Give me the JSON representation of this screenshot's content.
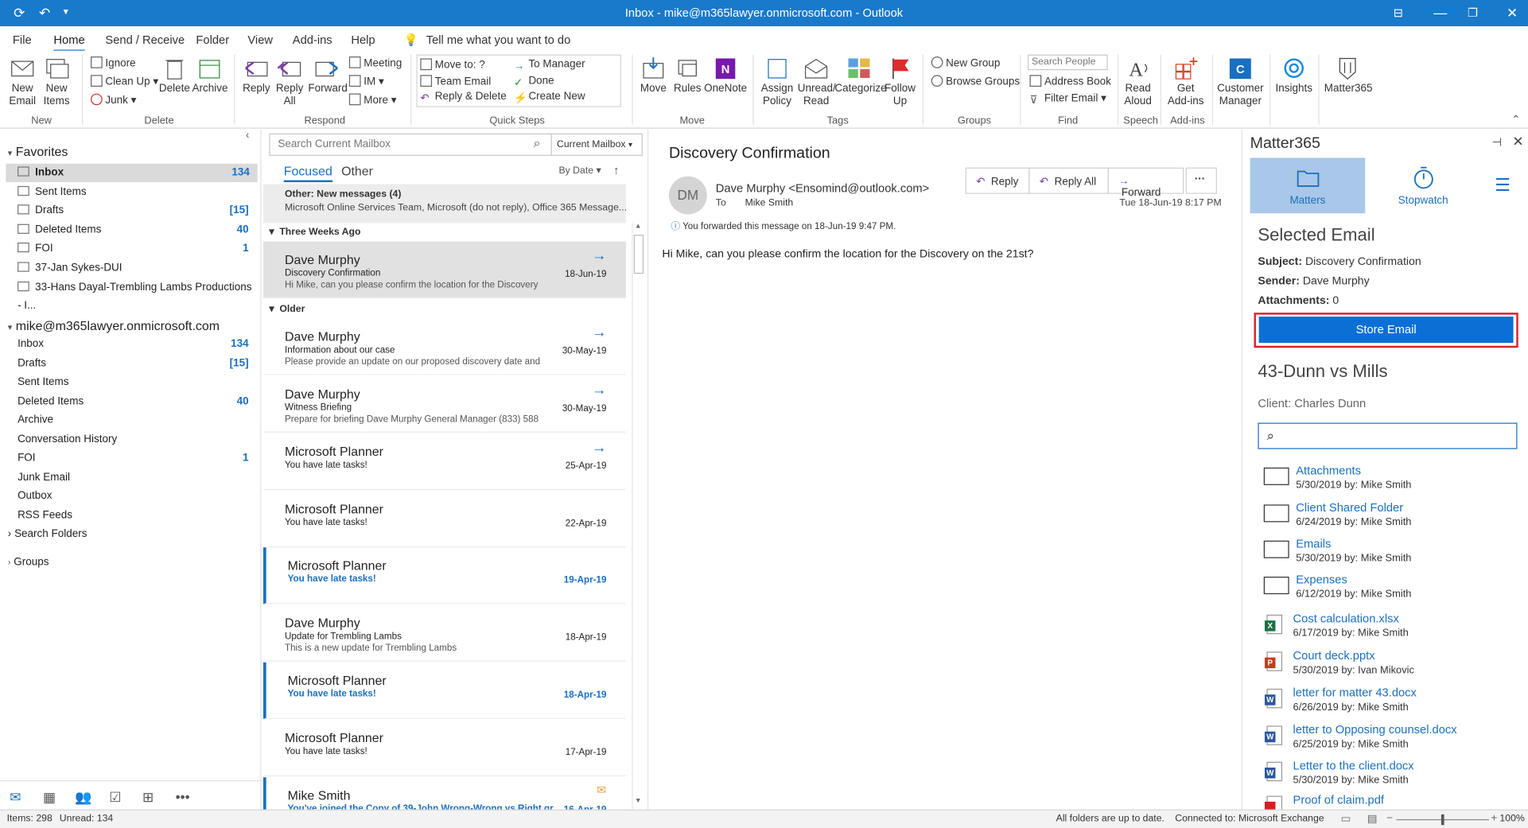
{
  "titlebar": {
    "title": "Inbox - mike@m365lawyer.onmicrosoft.com  -  Outlook"
  },
  "tabs": [
    "File",
    "Home",
    "Send / Receive",
    "Folder",
    "View",
    "Add-ins",
    "Help"
  ],
  "tell_me": "Tell me what you want to do",
  "ribbon": {
    "new_email": "New Email",
    "new_items": "New Items",
    "ignore": "Ignore",
    "clean_up": "Clean Up",
    "junk": "Junk",
    "delete": "Delete",
    "archive": "Archive",
    "reply": "Reply",
    "reply_all": "Reply All",
    "forward": "Forward",
    "meeting": "Meeting",
    "im": "IM",
    "more": "More",
    "quick_steps": [
      "Move to: ?",
      "To Manager",
      "Team Email",
      "Done",
      "Reply & Delete",
      "Create New"
    ],
    "move": "Move",
    "rules": "Rules",
    "onenote": "OneNote",
    "assign_policy": "Assign Policy",
    "unread_read": "Unread/ Read",
    "categorize": "Categorize",
    "follow_up": "Follow Up",
    "new_group": "New Group",
    "browse_groups": "Browse Groups",
    "search_people": "Search People",
    "address_book": "Address Book",
    "filter_email": "Filter Email",
    "read_aloud": "Read Aloud",
    "get_addins": "Get Add-ins",
    "customer_manager": "Customer Manager",
    "insights": "Insights",
    "matter365": "Matter365",
    "groups": [
      "New",
      "Delete",
      "Respond",
      "Quick Steps",
      "Move",
      "Tags",
      "Groups",
      "Find",
      "Speech",
      "Add-ins"
    ]
  },
  "nav": {
    "favorites": "Favorites",
    "fav_items": [
      {
        "label": "Inbox",
        "count": "134"
      },
      {
        "label": "Sent Items",
        "count": ""
      },
      {
        "label": "Drafts",
        "count": "[15]"
      },
      {
        "label": "Deleted Items",
        "count": "40"
      },
      {
        "label": "FOI",
        "count": "1"
      },
      {
        "label": "37-Jan Sykes-DUI",
        "count": ""
      },
      {
        "label": "33-Hans Dayal-Trembling Lambs Productions - I...",
        "count": ""
      }
    ],
    "account": "mike@m365lawyer.onmicrosoft.com",
    "acc_items": [
      {
        "label": "Inbox",
        "count": "134"
      },
      {
        "label": "Drafts",
        "count": "[15]"
      },
      {
        "label": "Sent Items",
        "count": ""
      },
      {
        "label": "Deleted Items",
        "count": "40"
      },
      {
        "label": "Archive",
        "count": ""
      },
      {
        "label": "Conversation History",
        "count": ""
      },
      {
        "label": "FOI",
        "count": "1"
      },
      {
        "label": "Junk Email",
        "count": ""
      },
      {
        "label": "Outbox",
        "count": ""
      },
      {
        "label": "RSS Feeds",
        "count": ""
      },
      {
        "label": "Search Folders",
        "count": ""
      }
    ],
    "groups": "Groups"
  },
  "list": {
    "search_placeholder": "Search Current Mailbox",
    "scope": "Current Mailbox",
    "focused": "Focused",
    "other": "Other",
    "sort": "By Date",
    "other_notice_title": "Other: New messages (4)",
    "other_notice_text": "Microsoft Online Services Team, Microsoft (do not reply), Office 365 Message...",
    "group_three_weeks": "Three Weeks Ago",
    "group_older": "Older",
    "messages": [
      {
        "sender": "Dave Murphy",
        "subject": "Discovery Confirmation",
        "preview": "Hi Mike, can you please confirm the location for the Discovery",
        "date": "18-Jun-19"
      },
      {
        "sender": "Dave Murphy",
        "subject": "Information about our case",
        "preview": "Please provide an update on our proposed discovery date and",
        "date": "30-May-19"
      },
      {
        "sender": "Dave Murphy",
        "subject": "Witness Briefing",
        "preview": "Prepare for briefing   Dave Murphy  General Manager  (833) 588",
        "date": "30-May-19"
      },
      {
        "sender": "Microsoft Planner",
        "subject": "You have late tasks!",
        "preview": "",
        "date": "25-Apr-19"
      },
      {
        "sender": "Microsoft Planner",
        "subject": "You have late tasks!",
        "preview": "",
        "date": "22-Apr-19"
      },
      {
        "sender": "Microsoft Planner",
        "subject": "You have late tasks!",
        "preview": "",
        "date": "19-Apr-19"
      },
      {
        "sender": "Dave Murphy",
        "subject": "Update for Trembling Lambs",
        "preview": "This is a new update for Trembling Lambs",
        "date": "18-Apr-19"
      },
      {
        "sender": "Microsoft Planner",
        "subject": "You have late tasks!",
        "preview": "",
        "date": "18-Apr-19"
      },
      {
        "sender": "Microsoft Planner",
        "subject": "You have late tasks!",
        "preview": "",
        "date": "17-Apr-19"
      },
      {
        "sender": "Mike Smith",
        "subject": "You've joined the Copy of 39-John Wrong-Wrong vs Right gr...",
        "preview": "",
        "date": "16-Apr-19"
      }
    ]
  },
  "reading": {
    "subject": "Discovery Confirmation",
    "initials": "DM",
    "from": "Dave Murphy <Ensomind@outlook.com>",
    "to_label": "To",
    "to": "Mike Smith",
    "reply": "Reply",
    "reply_all": "Reply All",
    "forward": "Forward",
    "date": "Tue 18-Jun-19 8:17 PM",
    "info": "You forwarded this message on 18-Jun-19 9:47 PM.",
    "body": "Hi Mike, can you please confirm the location for the Discovery on the 21st?"
  },
  "side": {
    "title": "Matter365",
    "tab_matters": "Matters",
    "tab_stopwatch": "Stopwatch",
    "selected_email": "Selected Email",
    "subject_label": "Subject:",
    "subject": "Discovery Confirmation",
    "sender_label": "Sender:",
    "sender": "Dave Murphy",
    "attach_label": "Attachments:",
    "attachments": "0",
    "store_email": "Store Email",
    "matter": "43-Dunn vs Mills",
    "client": "Client: Charles Dunn",
    "files": [
      {
        "name": "Attachments",
        "meta": "5/30/2019 by: Mike Smith",
        "type": "folder"
      },
      {
        "name": "Client Shared Folder",
        "meta": "6/24/2019 by: Mike Smith",
        "type": "folder"
      },
      {
        "name": "Emails",
        "meta": "5/30/2019 by: Mike Smith",
        "type": "folder"
      },
      {
        "name": "Expenses",
        "meta": "6/12/2019 by: Mike Smith",
        "type": "folder"
      },
      {
        "name": "Cost calculation.xlsx",
        "meta": "6/17/2019 by: Mike Smith",
        "type": "xlsx"
      },
      {
        "name": "Court deck.pptx",
        "meta": "5/30/2019 by: Ivan Mikovic",
        "type": "pptx"
      },
      {
        "name": "letter for matter 43.docx",
        "meta": "6/26/2019 by: Mike Smith",
        "type": "docx"
      },
      {
        "name": "letter to Opposing counsel.docx",
        "meta": "6/25/2019 by: Mike Smith",
        "type": "docx"
      },
      {
        "name": "Letter to the client.docx",
        "meta": "5/30/2019 by: Mike Smith",
        "type": "docx"
      },
      {
        "name": "Proof of claim.pdf",
        "meta": "",
        "type": "pdf"
      }
    ],
    "colors": {
      "store": "#0b6fd6",
      "highlight": "#e01f26",
      "tab_active": "#a9c7e8"
    }
  },
  "status": {
    "items": "Items: 298",
    "unread": "Unread: 134",
    "sync": "All folders are up to date.",
    "connected": "Connected to: Microsoft Exchange",
    "zoom": "100%"
  }
}
